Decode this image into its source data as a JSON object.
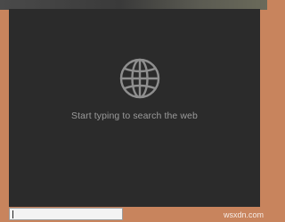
{
  "search_panel": {
    "message": "Start typing to search the web",
    "icon": "globe-icon"
  },
  "search_box": {
    "value": "",
    "placeholder": ""
  },
  "watermark": "wsxdn.com",
  "colors": {
    "panel_background": "#2b2b2b",
    "desktop_background": "#c8845d",
    "message_text": "#9b9b9b"
  }
}
